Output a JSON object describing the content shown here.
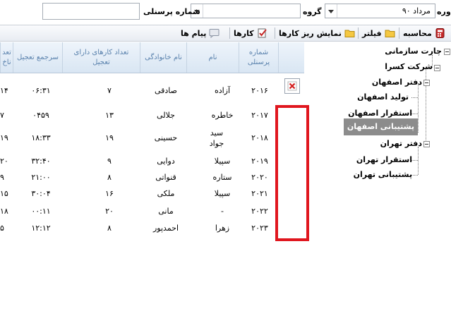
{
  "filters": {
    "period_label": "دوره",
    "period_value": "مرداد ۹۰",
    "group_label": "گروه",
    "group_value": "",
    "personnel_label": "شماره پرسنلی",
    "personnel_value": ""
  },
  "toolbar": {
    "calculate": "محاسبه",
    "filter": "فیلتر",
    "show_task_details": "نمایش ریز کارها",
    "tasks": "کارها",
    "messages": "پیام ها"
  },
  "grid": {
    "headers": {
      "personnel_no": "شماره پرسنلی",
      "first_name": "نام",
      "last_name": "نام خانوادگی",
      "late_tasks": "تعداد کارهای دارای تعجیل",
      "late_total": "سرجمع تعجیل",
      "cut_col": "تعد ناخ"
    },
    "rows": [
      {
        "id": "۲۰۱۶",
        "first": "آزاده",
        "last": "صادقی",
        "count": "۷",
        "total": "۰۶:۳۱",
        "cut": "۱۴"
      },
      {
        "id": "۲۰۱۷",
        "first": "خاطره",
        "last": "جلالی",
        "count": "۱۳",
        "total": "۰۴۵۹",
        "cut": "۷"
      },
      {
        "id": "۲۰۱۸",
        "first": "سید جواد",
        "last": "حسینی",
        "count": "۱۹",
        "total": "۱۸:۳۳",
        "cut": "۱۹"
      },
      {
        "id": "۲۰۱۹",
        "first": "سپیلا",
        "last": "دوایی",
        "count": "۹",
        "total": "۳۲:۴۰",
        "cut": "۲۰"
      },
      {
        "id": "۲۰۲۰",
        "first": "ستاره",
        "last": "قنواتی",
        "count": "۸",
        "total": "۲۱:۰۰",
        "cut": "۹"
      },
      {
        "id": "۲۰۲۱",
        "first": "سپیلا",
        "last": "ملکی",
        "count": "۱۶",
        "total": "۳۰:۰۴",
        "cut": "۱۵"
      },
      {
        "id": "۲۰۲۲",
        "first": "-",
        "last": "مانی",
        "count": "۲۰",
        "total": "۰۰:۱۱",
        "cut": "۱۸"
      },
      {
        "id": "۲۰۲۳",
        "first": "زهرا",
        "last": "احمدپور",
        "count": "۸",
        "total": "۱۲:۱۲",
        "cut": "۵"
      }
    ]
  },
  "tree": {
    "root": "چارت سازمانی",
    "company": "شرکت کسرا",
    "office_isfahan": "دفتر اصفهان",
    "isfahan_production": "تولید اصفهان",
    "isfahan_deploy": "استقرار اصفهان",
    "isfahan_support": "پشتیبانی اصفهان",
    "office_tehran": "دفتر تهران",
    "tehran_deploy": "استقرار تهران",
    "tehran_support": "پشتیبانی تهران"
  },
  "colors": {
    "highlight_border": "#e0161e",
    "header_text": "#5a82ad",
    "selected_node_bg": "#8c8c8c"
  }
}
